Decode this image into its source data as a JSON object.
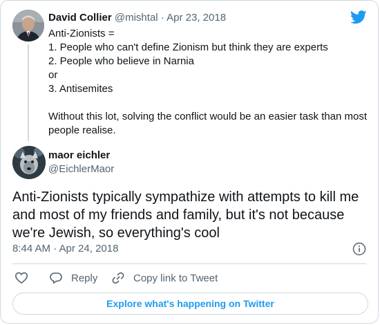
{
  "colors": {
    "brand_blue": "#1d9bf0",
    "text_primary": "#0f1419",
    "text_secondary": "#536471",
    "border": "#cfd9de"
  },
  "parent_tweet": {
    "author_name": "David Collier",
    "author_handle": "@mishtal",
    "separator": " · ",
    "date": "Apr 23, 2018",
    "lines": [
      "Anti-Zionists =",
      "1. People who can't define Zionism but think they are experts",
      "2. People who believe in Narnia",
      "or",
      "3. Antisemites"
    ],
    "closing_lines": [
      "Without this lot, solving the conflict would be an easier task than most",
      "people realise."
    ]
  },
  "main_tweet": {
    "author_name": "maor eichler",
    "author_handle": "@EichlerMaor",
    "text_lines": [
      "Anti-Zionists typically sympathize with attempts to kill me",
      "and most of my friends and family, but it's not because",
      "we're Jewish, so everything's cool"
    ],
    "timestamp": "8:44 AM · Apr 24, 2018"
  },
  "actions": {
    "like_icon": "heart-icon",
    "reply_label": "Reply",
    "reply_icon": "speech-bubble-icon",
    "copy_label": "Copy link to Tweet",
    "copy_icon": "link-icon",
    "info_icon": "info-icon"
  },
  "explore_button_label": "Explore what's happening on Twitter",
  "logo": "twitter-bird-icon"
}
